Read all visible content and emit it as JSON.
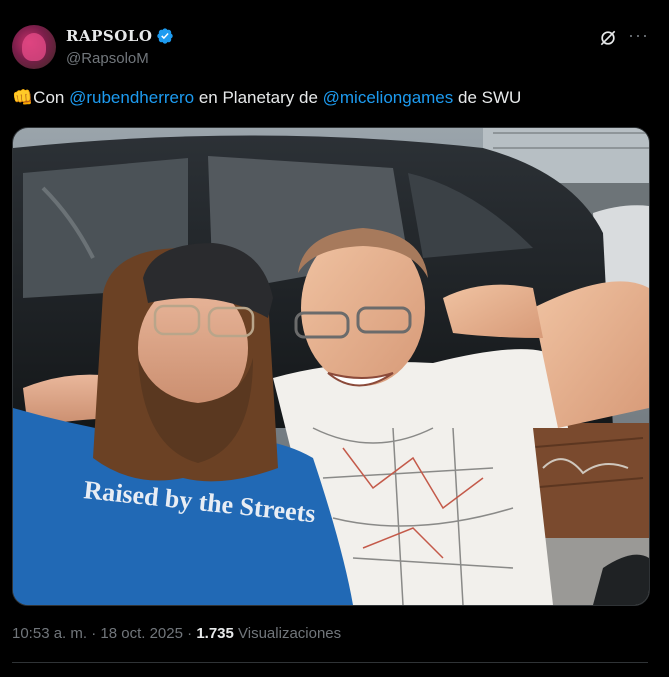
{
  "author": {
    "name": "RAPSOLO",
    "handle": "@RapsoloM",
    "verified": true
  },
  "icons": {
    "verified": "verified-badge-icon",
    "grok": "grok-icon",
    "more": "more-options-icon"
  },
  "tweet": {
    "emoji": "👊",
    "text_1": "Con ",
    "mention_1": "@rubendherrero",
    "text_2": " en Planetary de ",
    "mention_2": "@miceliongames",
    "text_3": " de SWU"
  },
  "media": {
    "shirt_text": "Raised by the Streets"
  },
  "meta": {
    "time": "10:53 a. m.",
    "sep1": " · ",
    "date": "18 oct. 2025",
    "sep2": " · ",
    "views_count": "1.735",
    "views_label": " Visualizaciones"
  },
  "colors": {
    "accent": "#1d9bf0",
    "background": "#000000",
    "text": "#e7e9ea",
    "muted": "#71767b",
    "border": "#2f3336"
  }
}
